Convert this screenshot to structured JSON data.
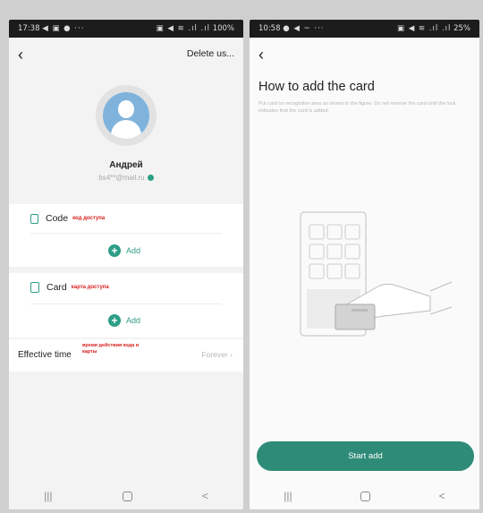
{
  "left_screen": {
    "status": {
      "time": "17:38",
      "left_symbols": "◀ ▣ ● ···",
      "right_symbols": "▣ ◀ ≋ .ıl .ıl",
      "battery": "100%"
    },
    "nav": {
      "delete_label": "Delete us..."
    },
    "profile": {
      "name": "Андрей",
      "email": "bs4**@mail.ru"
    },
    "code_section": {
      "label": "Code",
      "annotation": "код доступа",
      "add_label": "Add"
    },
    "card_section": {
      "label": "Card",
      "annotation": "карта доступа",
      "add_label": "Add"
    },
    "effective": {
      "label": "Effective time",
      "annotation": "время действия кода и карты",
      "value": "Forever"
    },
    "bottom_nav": {
      "recent": "|||",
      "back": "<"
    }
  },
  "right_screen": {
    "status": {
      "time": "10:58",
      "left_symbols": "● ◀ ~ ···",
      "right_symbols": "▣ ◀ ≋ .ıl .ıl",
      "battery": "25%"
    },
    "title": "How to add the card",
    "description": "Put card on recognition area as shown in the figure. Do not remove the card until the lock indicates that the card is added.",
    "start_button": "Start add",
    "bottom_nav": {
      "recent": "|||",
      "back": "<"
    }
  },
  "colors": {
    "accent": "#2e9e86",
    "button": "#2e8b77",
    "annotation": "#d8211f",
    "avatar": "#7fb3dc"
  },
  "icons": {
    "back": "chevron-left-icon",
    "code": "keypad-icon",
    "card": "card-icon",
    "add": "plus-circle-icon",
    "verified": "verified-icon"
  }
}
